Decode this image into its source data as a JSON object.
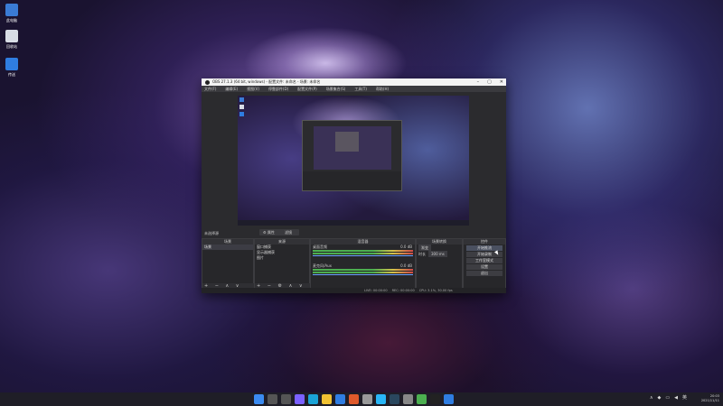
{
  "desktop": {
    "icons": [
      {
        "label": "此电脑",
        "color": "#3a7bd5",
        "icon": "computer-icon"
      },
      {
        "label": "回收站",
        "color": "#d8dde6",
        "icon": "recycle-bin-icon"
      },
      {
        "label": "传送",
        "color": "#2f7de1",
        "icon": "transfer-app-icon"
      }
    ]
  },
  "obs": {
    "title": "OBS 27.1.3 (64 bit, windows) - 配置文件: 未命名 - 场景: 未命名",
    "menu": [
      "文件(F)",
      "编辑(E)",
      "视图(V)",
      "停靠部件(D)",
      "配置文件(P)",
      "场景集合(S)",
      "工具(T)",
      "帮助(H)"
    ],
    "toolbar_label": "未选择源",
    "props_label": "属性",
    "filters_label": "滤镜",
    "scenes": {
      "header": "场景",
      "items": [
        "场景"
      ],
      "footer": "+ − ∧ ∨"
    },
    "sources": {
      "header": "来源",
      "items": [
        "窗口捕获",
        "显示器捕获",
        "图片"
      ],
      "footer": "+ − ⚙ ∧ ∨"
    },
    "mixer": {
      "header": "混音器",
      "channels": [
        {
          "name": "桌面音频",
          "level": "0.0 dB"
        },
        {
          "name": "麦克风/Aux",
          "level": "0.0 dB"
        }
      ]
    },
    "transitions": {
      "header": "场景转换",
      "type": "渐变",
      "duration_label": "时长",
      "duration": "300 ms"
    },
    "controls": {
      "header": "控件",
      "buttons": [
        "开始推流",
        "开始录制",
        "工作室模式",
        "设置",
        "退出"
      ]
    },
    "status": [
      "LIVE: 00:00:00",
      "REC: 00:00:00",
      "CPU: 3.1%, 30.00 fps"
    ]
  },
  "taskbar": {
    "apps": [
      {
        "name": "windows-start-icon",
        "color": "#3b8bf0"
      },
      {
        "name": "search-icon",
        "color": "#555"
      },
      {
        "name": "task-view-icon",
        "color": "#555"
      },
      {
        "name": "chat-icon",
        "color": "#7b61ff"
      },
      {
        "name": "edge-icon",
        "color": "#1aa3d6"
      },
      {
        "name": "explorer-icon",
        "color": "#f1c232"
      },
      {
        "name": "store-icon",
        "color": "#2f7de1"
      },
      {
        "name": "app-icon",
        "color": "#e05a2b"
      },
      {
        "name": "app-icon",
        "color": "#999"
      },
      {
        "name": "app-icon",
        "color": "#29b6f6"
      },
      {
        "name": "steam-icon",
        "color": "#2a475e"
      },
      {
        "name": "app-icon",
        "color": "#888"
      },
      {
        "name": "app-icon",
        "color": "#4caf50"
      },
      {
        "name": "obs-icon",
        "color": "#222"
      },
      {
        "name": "app-icon",
        "color": "#2f7de1"
      }
    ],
    "tray_lang": "英",
    "time": "20:03",
    "date": "2021/11/11"
  }
}
